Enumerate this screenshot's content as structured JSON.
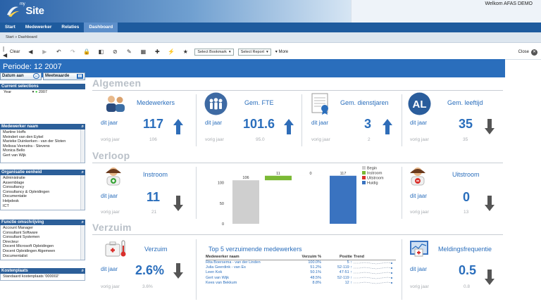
{
  "header": {
    "logo_prefix": "my",
    "logo_text": "Site",
    "welcome": "Welkom AFAS DEMO"
  },
  "nav": {
    "items": [
      {
        "label": "Start"
      },
      {
        "label": "Medewerker"
      },
      {
        "label": "Relaties"
      },
      {
        "label": "Dashboard"
      }
    ],
    "active": "Dashboard"
  },
  "breadcrumb": "Start » Dashboard",
  "toolbar": {
    "clear": "Clear",
    "bookmark_select": "Select Bookmark",
    "report_select": "Select Report",
    "more": "More",
    "close": "Close"
  },
  "period": "Periode: 12 2007",
  "sidebar": {
    "datum_aan": "Datum aan",
    "meetwaarde": "Meetwaarde",
    "current_selections": {
      "title": "Current selections",
      "field": "Year",
      "value": "2007"
    },
    "medewerker": {
      "title": "Medewerker naam",
      "items": [
        "Martine Hoffs",
        "Meindert van den Eykel",
        "Marieke Duinkerken - van der Sloten",
        "Melissa Veenstra - Stevens",
        "Monica Bello",
        "Gert van Wijk"
      ]
    },
    "organisatie": {
      "title": "Organisatie eenheid",
      "items": [
        "Administratie",
        "Assemblage",
        "Consultancy",
        "Consultancy & Opleidingen",
        "Documentatie",
        "Helpdesk",
        "ICT"
      ]
    },
    "functie": {
      "title": "Functie omschrijving",
      "items": [
        "Account Manager",
        "Consultant Software",
        "Consultant Systemen",
        "Directeur",
        "Docent Microsoft Opleidingen",
        "Docent Opleidingen Algemeen",
        "Documentalist"
      ]
    },
    "kostenplaats": {
      "title": "Kostenplaats",
      "items": [
        "Standaard kostenplaats '000002'"
      ]
    }
  },
  "sections": {
    "algemeen": "Algemeen",
    "verloop": "Verloop",
    "verzuim": "Verzuim"
  },
  "labels": {
    "dit_jaar": "dit jaar",
    "vorig_jaar": "vorig jaar"
  },
  "kpis": {
    "medewerkers": {
      "title": "Medewerkers",
      "value": "117",
      "prev": "106"
    },
    "fte": {
      "title": "Gem. FTE",
      "value": "101.6",
      "prev": "95.0"
    },
    "dienstjaren": {
      "title": "Gem. dienstjaren",
      "value": "3",
      "prev": "2"
    },
    "leeftijd": {
      "title": "Gem. leeftijd",
      "value": "35",
      "prev": "35",
      "icon_text": "AL"
    },
    "instroom": {
      "title": "Instroom",
      "value": "11",
      "prev": "21"
    },
    "uitstroom": {
      "title": "Uitstroom",
      "value": "0",
      "prev": "13"
    },
    "verzuim": {
      "title": "Verzuim",
      "value": "2.6%",
      "prev": "3.6%"
    },
    "meldingsfrequentie": {
      "title": "Meldingsfrequentie",
      "value": "0.5",
      "prev": "0.8"
    }
  },
  "chart_data": {
    "type": "bar",
    "categories": [
      "Begin",
      "Instroom",
      "Uitstroom",
      "Huidig"
    ],
    "values": [
      106,
      11,
      0,
      117
    ],
    "data_labels": [
      "106",
      "11",
      "0",
      "117"
    ],
    "yticks": [
      "0",
      "50",
      "100"
    ],
    "ylim": [
      0,
      120
    ],
    "colors": [
      "#cfcfcf",
      "#7bb935",
      "#d9302c",
      "#3a73c0"
    ],
    "legend": [
      "Begin",
      "Instroom",
      "Uitstroom",
      "Huidig"
    ],
    "legend_position": "top-right"
  },
  "top5": {
    "title": "Top 5 verzuimende medewerkers",
    "columns": [
      "Medewerker naam",
      "Verzuim %",
      "Positie",
      "Trend"
    ],
    "rows": [
      {
        "name": "Rita Boersema - van der Linden",
        "pct": "100.0%",
        "pos": "5"
      },
      {
        "name": "Julia Geerdink - van Es",
        "pct": "51.2%",
        "pos": "52-119"
      },
      {
        "name": "Leen Kok",
        "pct": "50.1%",
        "pos": "47-51"
      },
      {
        "name": "Gert van Wijk",
        "pct": "48.5%",
        "pos": "52-119"
      },
      {
        "name": "Kees van Bekkum",
        "pct": "8.8%",
        "pos": "12"
      }
    ]
  },
  "colors": {
    "accent": "#2a6ebc",
    "nav": "#1e5b9e",
    "arrow": "#2f6db8",
    "arrow_down": "#555555"
  }
}
